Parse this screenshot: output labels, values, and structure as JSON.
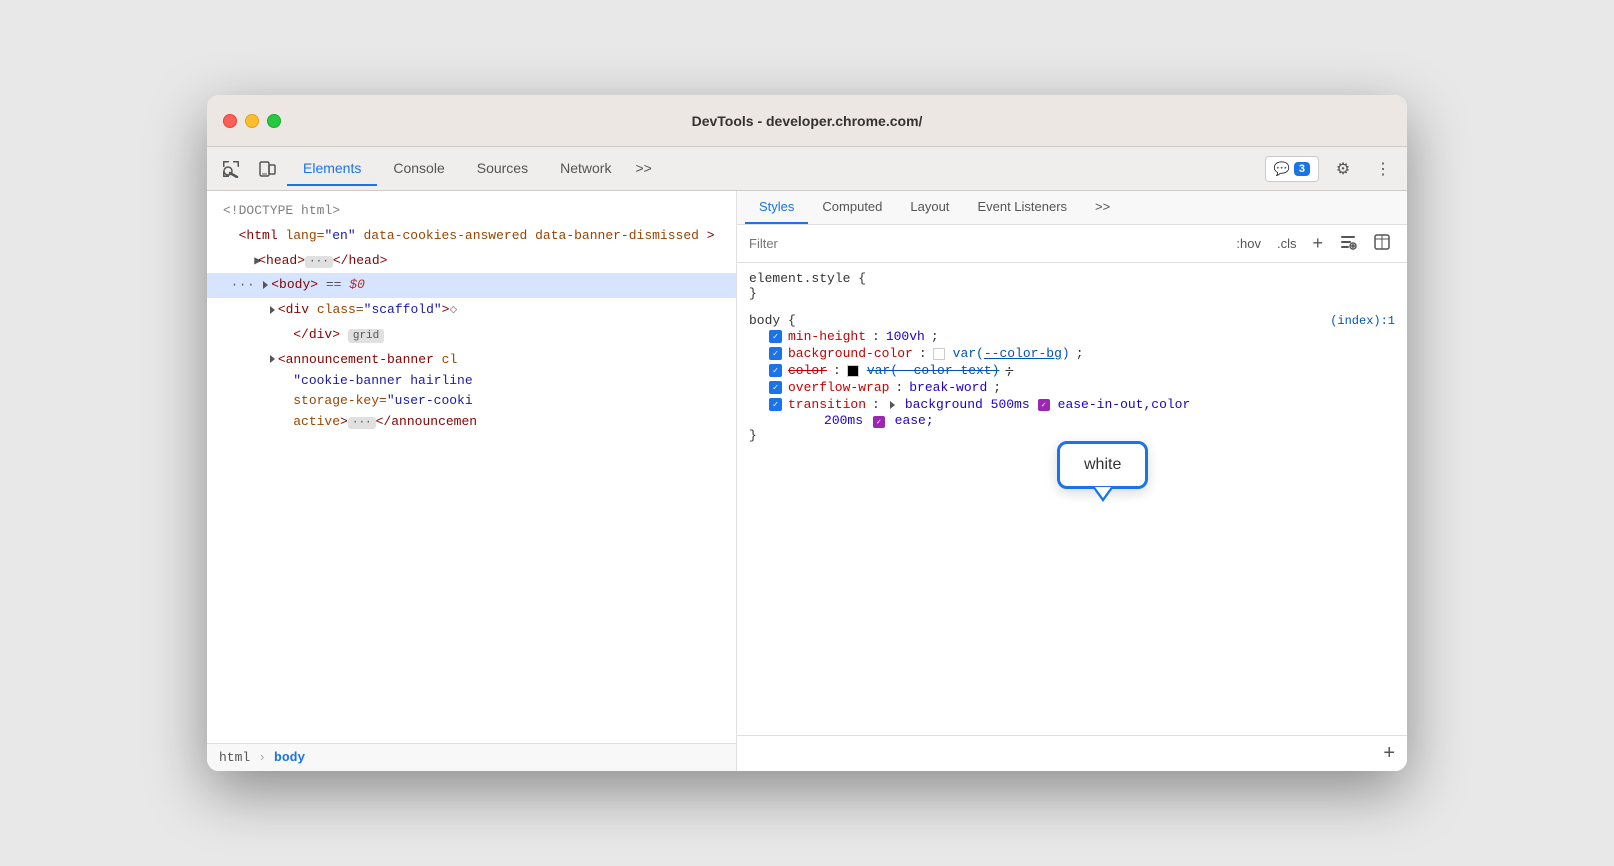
{
  "window": {
    "title": "DevTools - developer.chrome.com/"
  },
  "toolbar": {
    "tabs": [
      {
        "id": "elements",
        "label": "Elements",
        "active": true
      },
      {
        "id": "console",
        "label": "Console",
        "active": false
      },
      {
        "id": "sources",
        "label": "Sources",
        "active": false
      },
      {
        "id": "network",
        "label": "Network",
        "active": false
      },
      {
        "id": "more",
        "label": ">>",
        "active": false
      }
    ],
    "badge_label": "3",
    "settings_label": "⚙",
    "menu_label": "⋮"
  },
  "elements_panel": {
    "dom_lines": [
      {
        "id": "doctype",
        "text": "<!DOCTYPE html>",
        "indent": 0
      },
      {
        "id": "html-open",
        "indent": 0
      },
      {
        "id": "head",
        "indent": 1
      },
      {
        "id": "body",
        "indent": 1
      },
      {
        "id": "div-scaffold",
        "indent": 2
      },
      {
        "id": "div-end",
        "indent": 3
      },
      {
        "id": "announcement",
        "indent": 2
      }
    ],
    "breadcrumb": [
      "html",
      "body"
    ]
  },
  "styles_panel": {
    "tabs": [
      {
        "id": "styles",
        "label": "Styles",
        "active": true
      },
      {
        "id": "computed",
        "label": "Computed",
        "active": false
      },
      {
        "id": "layout",
        "label": "Layout",
        "active": false
      },
      {
        "id": "event-listeners",
        "label": "Event Listeners",
        "active": false
      },
      {
        "id": "more",
        "label": ">>",
        "active": false
      }
    ],
    "filter_placeholder": "Filter",
    "filter_actions": [
      ":hov",
      ".cls",
      "+"
    ],
    "element_style_selector": "element.style {",
    "element_style_close": "}",
    "body_selector": "body {",
    "body_close": "}",
    "body_link": "(index):1",
    "css_props": [
      {
        "id": "min-height",
        "name": "min-height",
        "value": "100vh",
        "checked": true
      },
      {
        "id": "background-color",
        "name": "background-color",
        "value": "var(--color-bg)",
        "swatch_color": "#ffffff",
        "checked": true,
        "has_link": true
      },
      {
        "id": "color",
        "name": "color",
        "value": "var(--color-text)",
        "swatch_color": "#000000",
        "checked": true,
        "strikethrough": true
      },
      {
        "id": "overflow-wrap",
        "name": "overflow-wrap",
        "value": "break-word",
        "checked": true
      },
      {
        "id": "transition",
        "name": "transition",
        "value_parts": [
          "background 500ms",
          "ease-in-out,color",
          "200ms",
          "ease;"
        ],
        "checked": true,
        "has_triangle": true
      }
    ],
    "tooltip": {
      "text": "white",
      "visible": true
    }
  }
}
